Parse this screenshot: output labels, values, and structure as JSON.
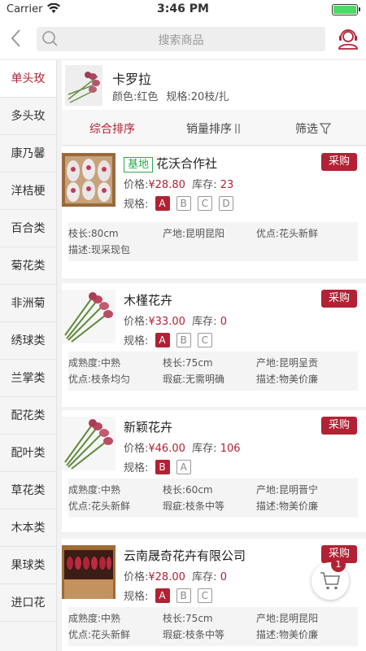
{
  "status": {
    "carrier": "Carrier",
    "time": "3:46 PM"
  },
  "search": {
    "placeholder": "搜索商品"
  },
  "categories": [
    "单头玫",
    "多头玫",
    "康乃馨",
    "洋桔梗",
    "百合类",
    "菊花类",
    "非洲菊",
    "绣球类",
    "兰掌类",
    "配花类",
    "配叶类",
    "草花类",
    "木本类",
    "果球类",
    "进口花"
  ],
  "product": {
    "name": "卡罗拉",
    "color_label": "颜色:红色",
    "spec_label": "规格:20枝/扎"
  },
  "sort": {
    "comprehensive": "综合排序",
    "sales": "销量排序",
    "filter": "筛选"
  },
  "labels": {
    "price": "价格:",
    "stock": "库存:",
    "spec": "规格:",
    "buy": "采购"
  },
  "listings": [
    {
      "tag": "基地",
      "supplier": "花沃合作社",
      "price": "¥28.80",
      "stock": "23",
      "specs": [
        "A",
        "B",
        "C",
        "D"
      ],
      "attrs": [
        [
          "枝长:80cm",
          "产地:昆明昆阳",
          "优点:花头新鲜"
        ],
        [
          "描述:现采现包",
          "",
          ""
        ]
      ]
    },
    {
      "tag": "",
      "supplier": "木槿花卉",
      "price": "¥33.00",
      "stock": "0",
      "specs": [
        "A",
        "B",
        "C"
      ],
      "attrs": [
        [
          "成熟度:中熟",
          "枝长:75cm",
          "产地:昆明呈贡"
        ],
        [
          "优点:枝条均匀",
          "瑕疵:无需明确",
          "描述:物美价廉"
        ]
      ]
    },
    {
      "tag": "",
      "supplier": "新颖花卉",
      "price": "¥46.00",
      "stock": "106",
      "specs": [
        "B",
        "A"
      ],
      "attrs": [
        [
          "成熟度:中熟",
          "枝长:60cm",
          "产地:昆明晋宁"
        ],
        [
          "优点:花头新鲜",
          "瑕疵:枝条中等",
          "描述:物美价廉"
        ]
      ]
    },
    {
      "tag": "",
      "supplier": "云南晟奇花卉有限公司",
      "price": "¥28.00",
      "stock": "0",
      "specs": [
        "A",
        "B",
        "C"
      ],
      "attrs": [
        [
          "成熟度:中熟",
          "枝长:75cm",
          "产地:昆明昆阳"
        ],
        [
          "优点:花头新鲜",
          "瑕疵:枝条中等",
          "描述:物美价廉"
        ]
      ]
    }
  ],
  "cart": {
    "count": "1"
  },
  "colors": {
    "accent": "#b22234",
    "tag_green": "#2fa84f"
  }
}
